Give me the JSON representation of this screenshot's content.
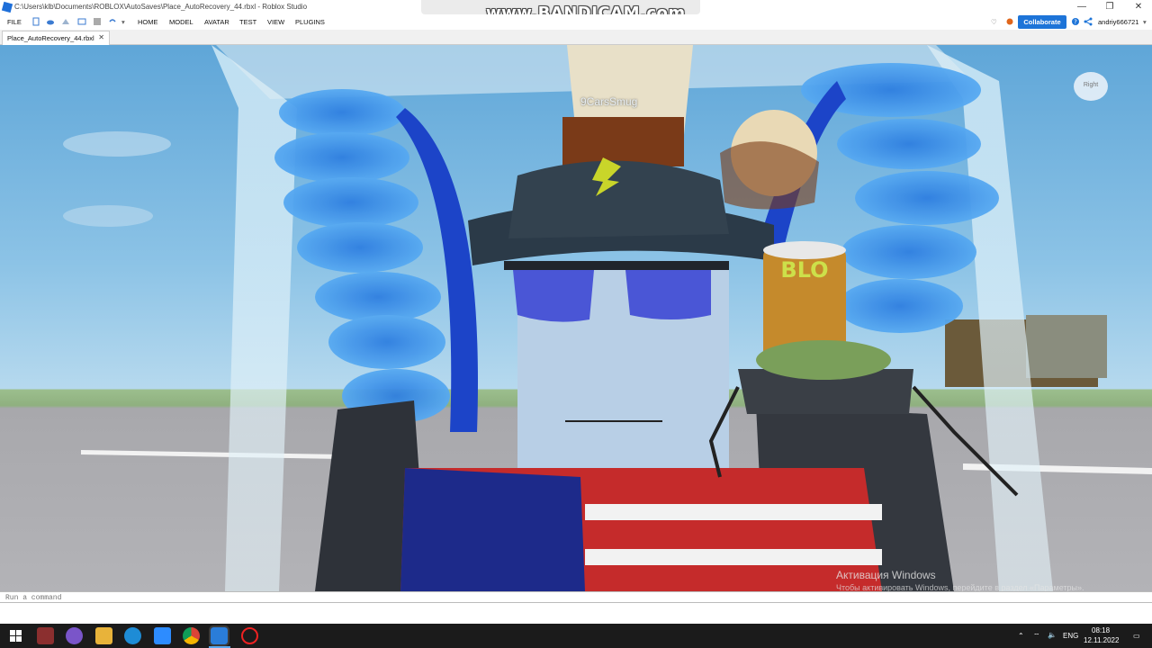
{
  "window": {
    "title": "C:\\Users\\klb\\Documents\\ROBLOX\\AutoSaves\\Place_AutoRecovery_44.rbxl - Roblox Studio",
    "minimize": "—",
    "maximize": "❐",
    "close": "✕"
  },
  "overlay": {
    "watermark": "www.BANDICAM.com"
  },
  "menu": {
    "items": [
      "FILE",
      "HOME",
      "MODEL",
      "AVATAR",
      "TEST",
      "VIEW",
      "PLUGINS"
    ],
    "collaborate": "Collaborate",
    "username": "andriy666721"
  },
  "tabs": [
    {
      "label": "Place_AutoRecovery_44.rbxl",
      "close": "✕"
    }
  ],
  "viewport": {
    "player_name": "9CarsSmug",
    "view_cube_label": "Right",
    "drink_text": "BLO",
    "activation_title": "Активация Windows",
    "activation_sub": "Чтобы активировать Windows, перейдите в раздел «Параметры»."
  },
  "command_bar": {
    "placeholder": "Run a command"
  },
  "taskbar": {
    "language": "ENG",
    "time": "08:18",
    "date": "12.11.2022"
  },
  "colors": {
    "accent": "#1d74d8",
    "taskbar": "#1b1b1b",
    "sky_top": "#5fa6d8",
    "skin": "#b8cfe6"
  }
}
